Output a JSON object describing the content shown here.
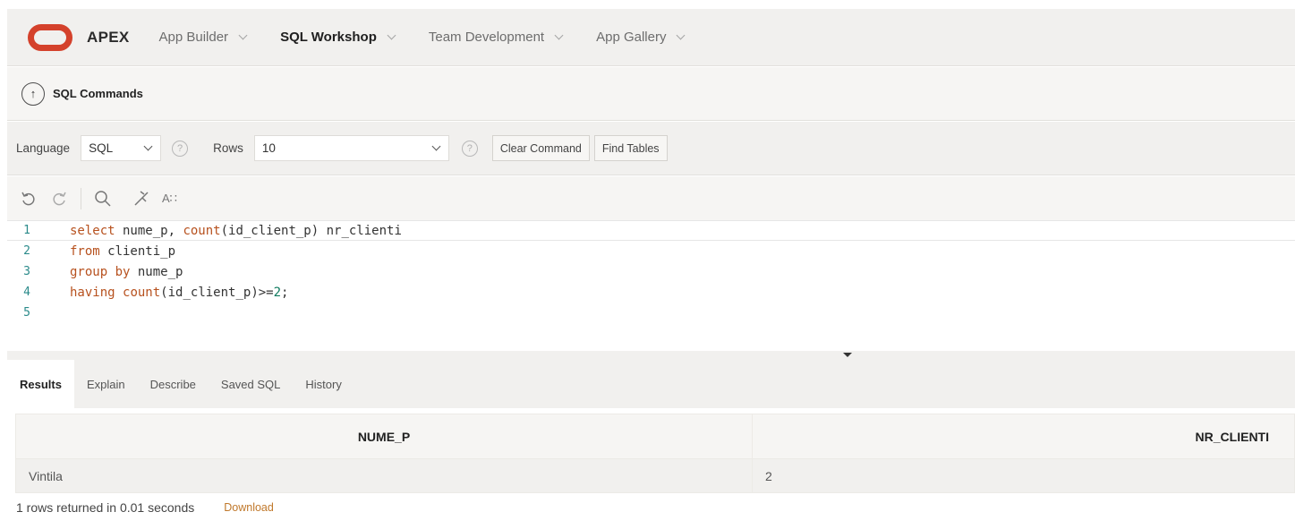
{
  "app": {
    "brand": "APEX",
    "accent_color": "#d4412b"
  },
  "nav": {
    "items": [
      {
        "label": "App Builder",
        "active": false
      },
      {
        "label": "SQL Workshop",
        "active": true
      },
      {
        "label": "Team Development",
        "active": false
      },
      {
        "label": "App Gallery",
        "active": false
      }
    ]
  },
  "breadcrumb": {
    "icon": "arrow-up-circle-icon",
    "title": "SQL Commands"
  },
  "options": {
    "language_label": "Language",
    "language_value": "SQL",
    "rows_label": "Rows",
    "rows_value": "10",
    "help_glyph": "?",
    "clear_command": "Clear Command",
    "find_tables": "Find Tables"
  },
  "editor_toolbar": {
    "icons": [
      "undo-icon",
      "redo-icon",
      "search-icon",
      "wrench-icon",
      "autocomplete-icon"
    ],
    "autocomplete_label": "A∷"
  },
  "editor": {
    "lines": [
      {
        "n": "1"
      },
      {
        "n": "2"
      },
      {
        "n": "3"
      },
      {
        "n": "4"
      },
      {
        "n": "5"
      }
    ],
    "tokens": {
      "l1_select": "select",
      "l1_rest_a": " nume_p, ",
      "l1_count": "count",
      "l1_rest_b": "(id_client_p) nr_clienti",
      "l2_from": "from",
      "l2_rest": " clienti_p",
      "l3_group": "group by",
      "l3_rest": " nume_p",
      "l4_having": "having",
      "l4_sp": " ",
      "l4_count": "count",
      "l4_rest": "(id_client_p)>=",
      "l4_num": "2",
      "l4_end": ";"
    }
  },
  "tabs": [
    {
      "label": "Results",
      "active": true
    },
    {
      "label": "Explain",
      "active": false
    },
    {
      "label": "Describe",
      "active": false
    },
    {
      "label": "Saved SQL",
      "active": false
    },
    {
      "label": "History",
      "active": false
    }
  ],
  "results": {
    "columns": [
      "NUME_P",
      "NR_CLIENTI"
    ],
    "rows": [
      [
        "Vintila",
        "2"
      ]
    ],
    "status": "1 rows returned in 0.01 seconds",
    "download": "Download"
  }
}
